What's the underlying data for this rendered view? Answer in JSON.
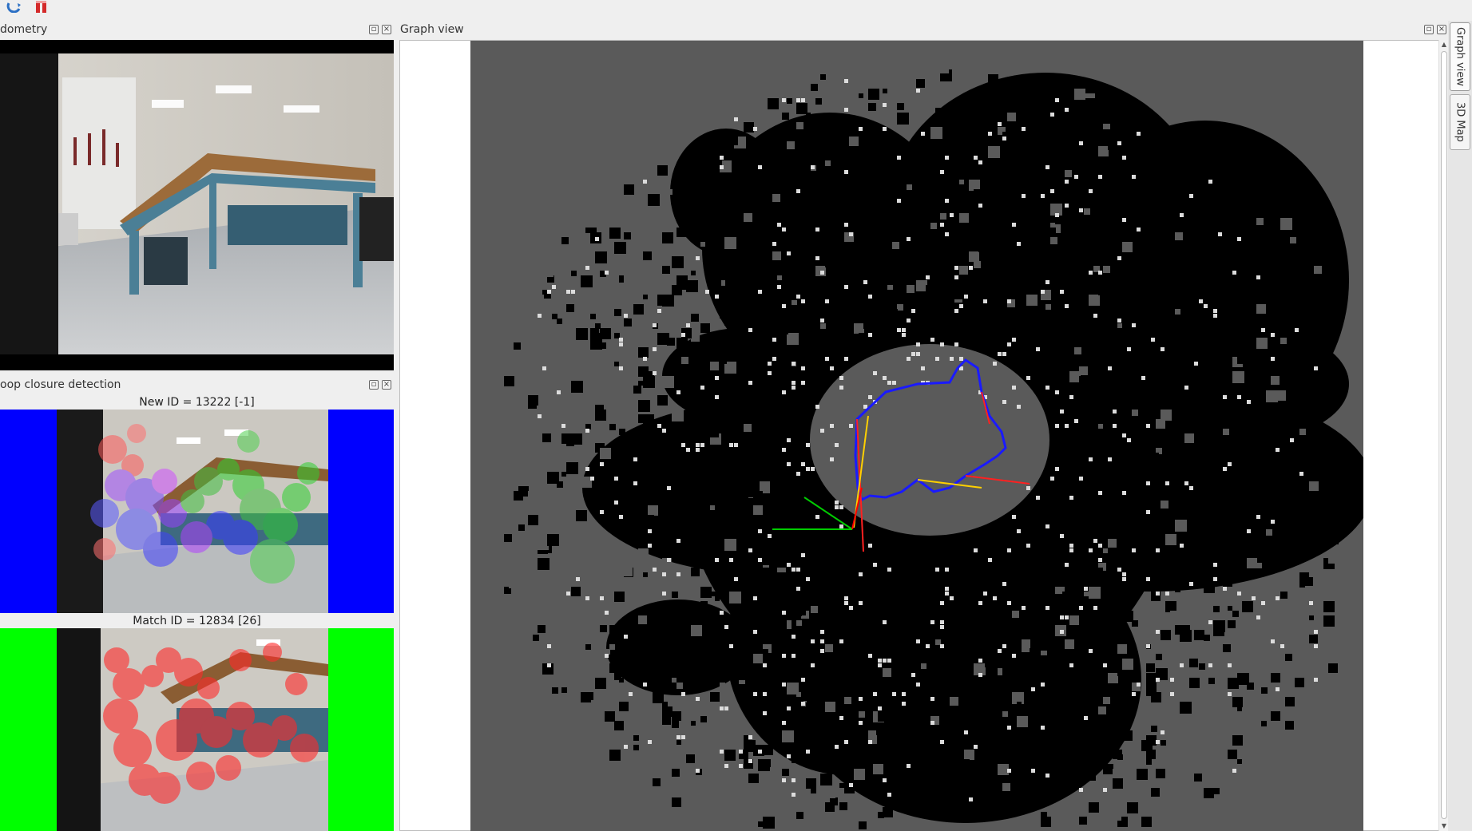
{
  "toolbar": {
    "icons": [
      "refresh-icon",
      "pause-icon"
    ]
  },
  "docks": {
    "odometry": {
      "title": "dometry"
    },
    "loop_closure": {
      "title": "oop closure detection",
      "new_caption": "New ID = 13222 [-1]",
      "match_caption": "Match ID = 12834 [26]",
      "new_border_color": "#0000ff",
      "match_border_color": "#00ff00"
    },
    "graph_view": {
      "title": "Graph view"
    }
  },
  "side_tabs": [
    {
      "label": "Graph view",
      "active": true
    },
    {
      "label": "3D Map",
      "active": false
    }
  ],
  "colors": {
    "map_unknown": "#5a5a5a",
    "map_free": "#000000",
    "map_obstacle": "#dcdcdc",
    "trajectory": "#1a1aff",
    "loop_links": "#ff2020",
    "neighbor_links": "#ffd000",
    "x_axis": "#ff0000",
    "y_axis": "#00cc00"
  }
}
